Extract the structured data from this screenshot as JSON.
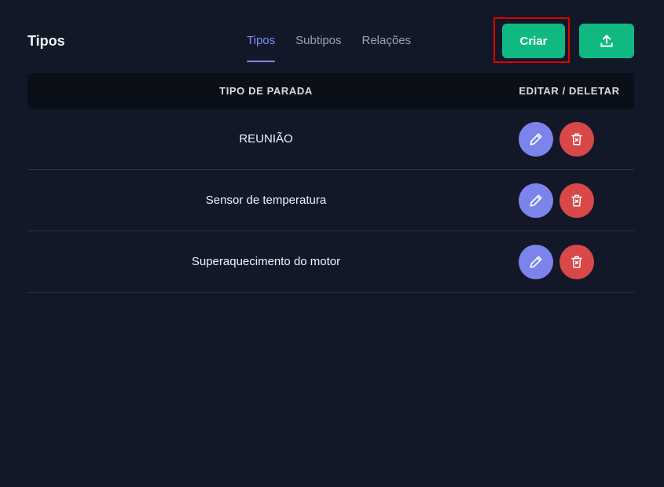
{
  "header": {
    "title": "Tipos",
    "tabs": [
      {
        "label": "Tipos",
        "active": true
      },
      {
        "label": "Subtipos",
        "active": false
      },
      {
        "label": "Relações",
        "active": false
      }
    ],
    "create_label": "Criar",
    "upload_icon": "upload-icon"
  },
  "table": {
    "columns": [
      "TIPO DE PARADA",
      "EDITAR / DELETAR"
    ],
    "rows": [
      {
        "name": "REUNIÃO"
      },
      {
        "name": "Sensor de temperatura"
      },
      {
        "name": "Superaquecimento do motor"
      }
    ]
  },
  "colors": {
    "background": "#121827",
    "accent": "#818cf8",
    "primary_green": "#10b981",
    "edit_button": "#7c84ec",
    "delete_button": "#d84848",
    "highlight_box": "#e00000"
  }
}
